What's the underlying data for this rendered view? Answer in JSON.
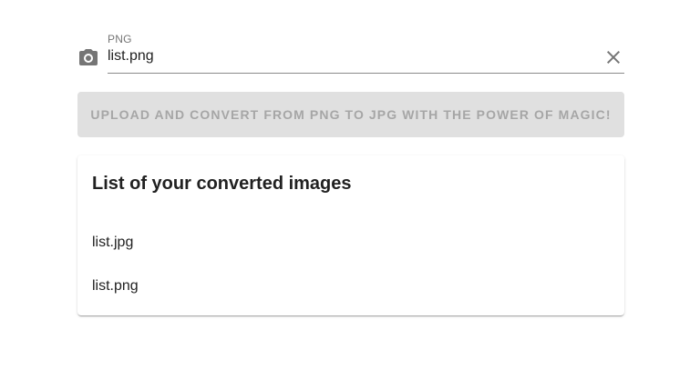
{
  "file_input": {
    "label": "PNG",
    "value": "list.png",
    "prepend_icon": "camera-icon",
    "clear_icon": "close-icon"
  },
  "upload_button": {
    "label": "UPLOAD AND CONVERT FROM PNG TO JPG WITH THE POWER OF MAGIC!",
    "disabled": true
  },
  "converted_card": {
    "title": "List of your converted images",
    "items": [
      {
        "name": "list.jpg"
      },
      {
        "name": "list.png"
      }
    ]
  },
  "colors": {
    "button_bg_disabled": "#e0e0e0",
    "button_text_disabled": "#a6a6a6",
    "icon": "#757575",
    "text": "#212121"
  }
}
